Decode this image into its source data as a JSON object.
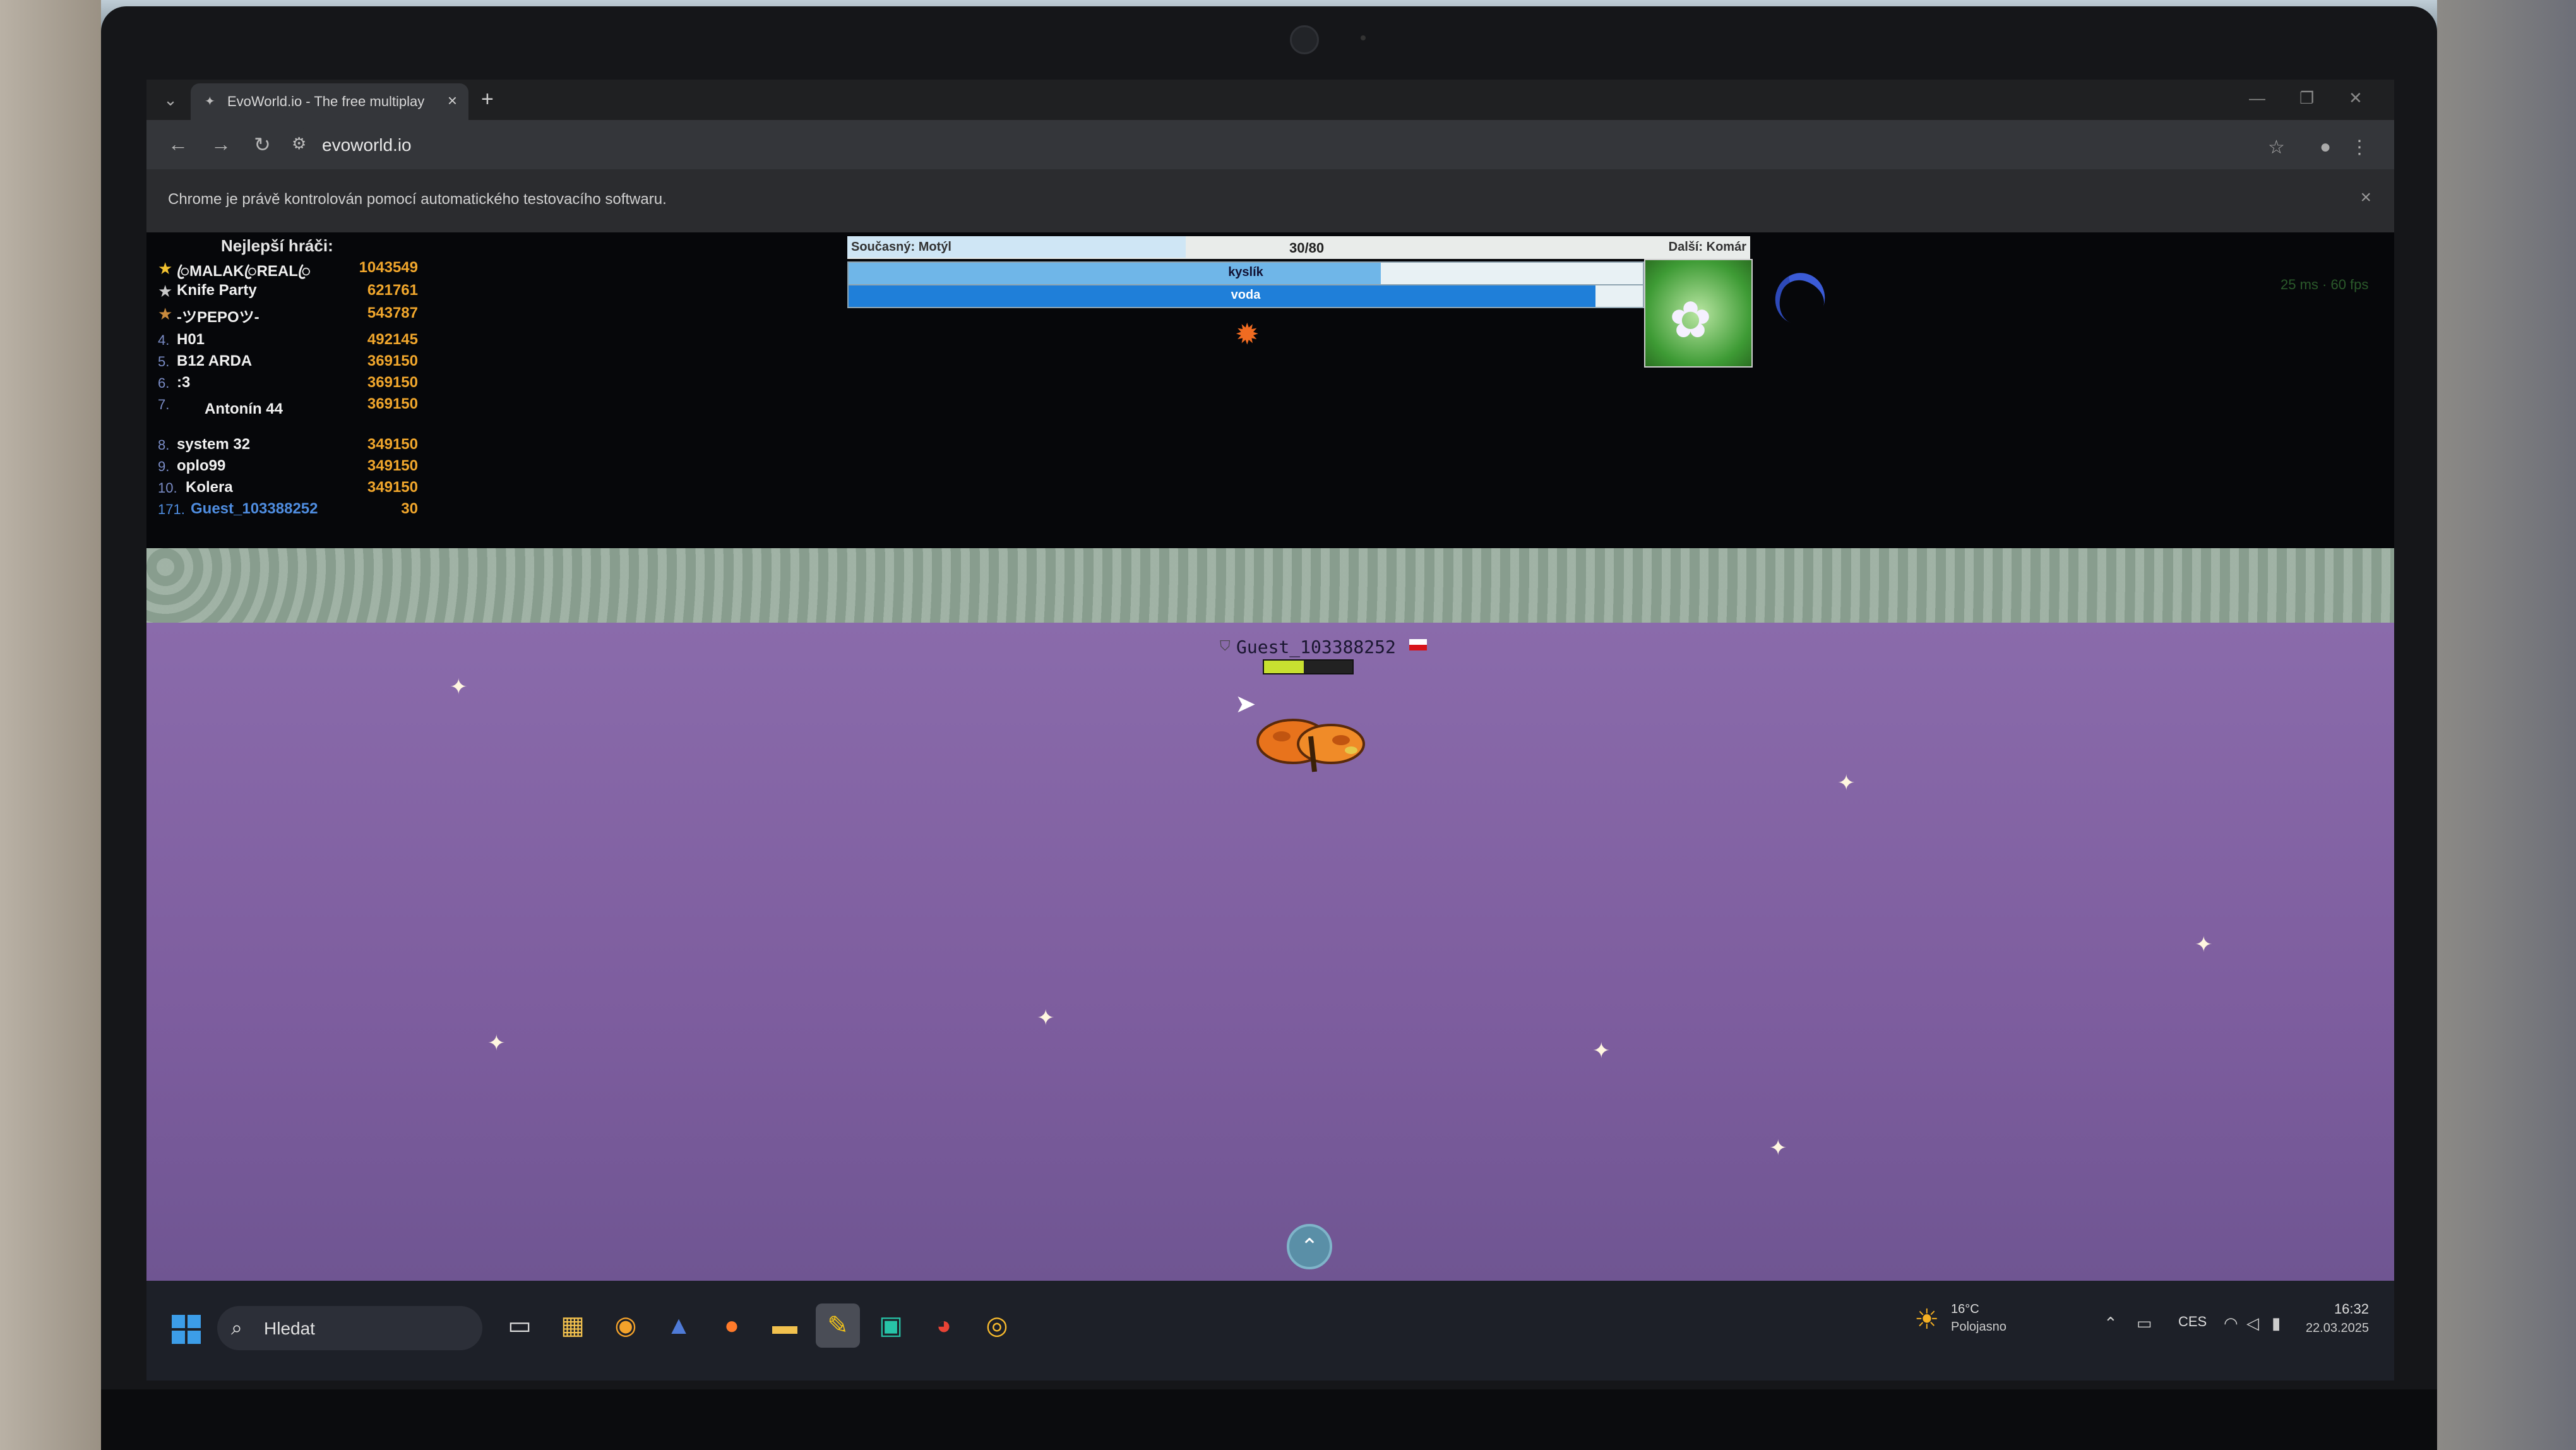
{
  "browser": {
    "tab_title": "EvoWorld.io - The free multiplay",
    "url": "evoworld.io",
    "infobar_text": "Chrome je právě kontrolován pomocí automatického testovacího softwaru.",
    "icons": [
      "tab-list-icon",
      "site-favicon-icon",
      "close-icon",
      "plus-icon",
      "minimize-icon",
      "restore-icon",
      "close-window-icon",
      "back-icon",
      "forward-icon",
      "reload-icon",
      "site-info-icon",
      "bookmark-star-icon",
      "profile-icon",
      "menu-dots-icon"
    ]
  },
  "leaderboard": {
    "title": "Nejlepší hráči:",
    "rows": [
      {
        "rank": "",
        "medal": "gold",
        "name": "ꦿMALAKꦿREALꦿ",
        "score": "1043549"
      },
      {
        "rank": "",
        "medal": "silver",
        "name": "Knife Party",
        "score": "621761"
      },
      {
        "rank": "",
        "medal": "bronze",
        "name": "-ツPEPOツ-",
        "score": "543787"
      },
      {
        "rank": "4.",
        "medal": "",
        "name": "H01",
        "score": "492145"
      },
      {
        "rank": "5.",
        "medal": "",
        "name": "B12 ARDA",
        "score": "369150"
      },
      {
        "rank": "6.",
        "medal": "",
        "name": ":3",
        "score": "369150"
      },
      {
        "rank": "7.",
        "medal": "",
        "name": "Antonín 44",
        "score": "369150"
      },
      {
        "rank": "8.",
        "medal": "",
        "name": "system 32",
        "score": "349150"
      },
      {
        "rank": "9.",
        "medal": "",
        "name": "oplo99",
        "score": "349150"
      },
      {
        "rank": "10.",
        "medal": "",
        "name": "Kolera",
        "score": "349150"
      },
      {
        "rank": "171.",
        "medal": "",
        "name": "Guest_103388252",
        "score": "30"
      }
    ]
  },
  "hud": {
    "current": "Současný: Motýl",
    "count": "30/80",
    "next": "Další: Komár",
    "oxygen_label": "kyslík",
    "oxygen_level": 0.67,
    "water_label": "voda",
    "water_level": 0.94,
    "xp_level": 0.375,
    "ping": "25 ms · 60 fps"
  },
  "player": {
    "name": "Guest_103388252",
    "health_level": 0.45
  },
  "taskbar": {
    "search_placeholder": "Hledat",
    "apps": [
      "task-view-icon",
      "store-icon",
      "browser-icon",
      "sky-icon",
      "firefox-icon",
      "file-explorer-icon",
      "sticky-notes-icon",
      "pycharm-icon",
      "chrome-beta-icon",
      "chrome-icon"
    ],
    "weather_temp": "16°C",
    "weather_cond": "Polojasno",
    "language": "CES",
    "time": "16:32",
    "date": "22.03.2025"
  },
  "colors": {
    "field": "#8a6bab",
    "oxygen": "#6fb6e8",
    "water": "#1f7fd9",
    "score": "#f0a62c",
    "self": "#4f8de0"
  }
}
